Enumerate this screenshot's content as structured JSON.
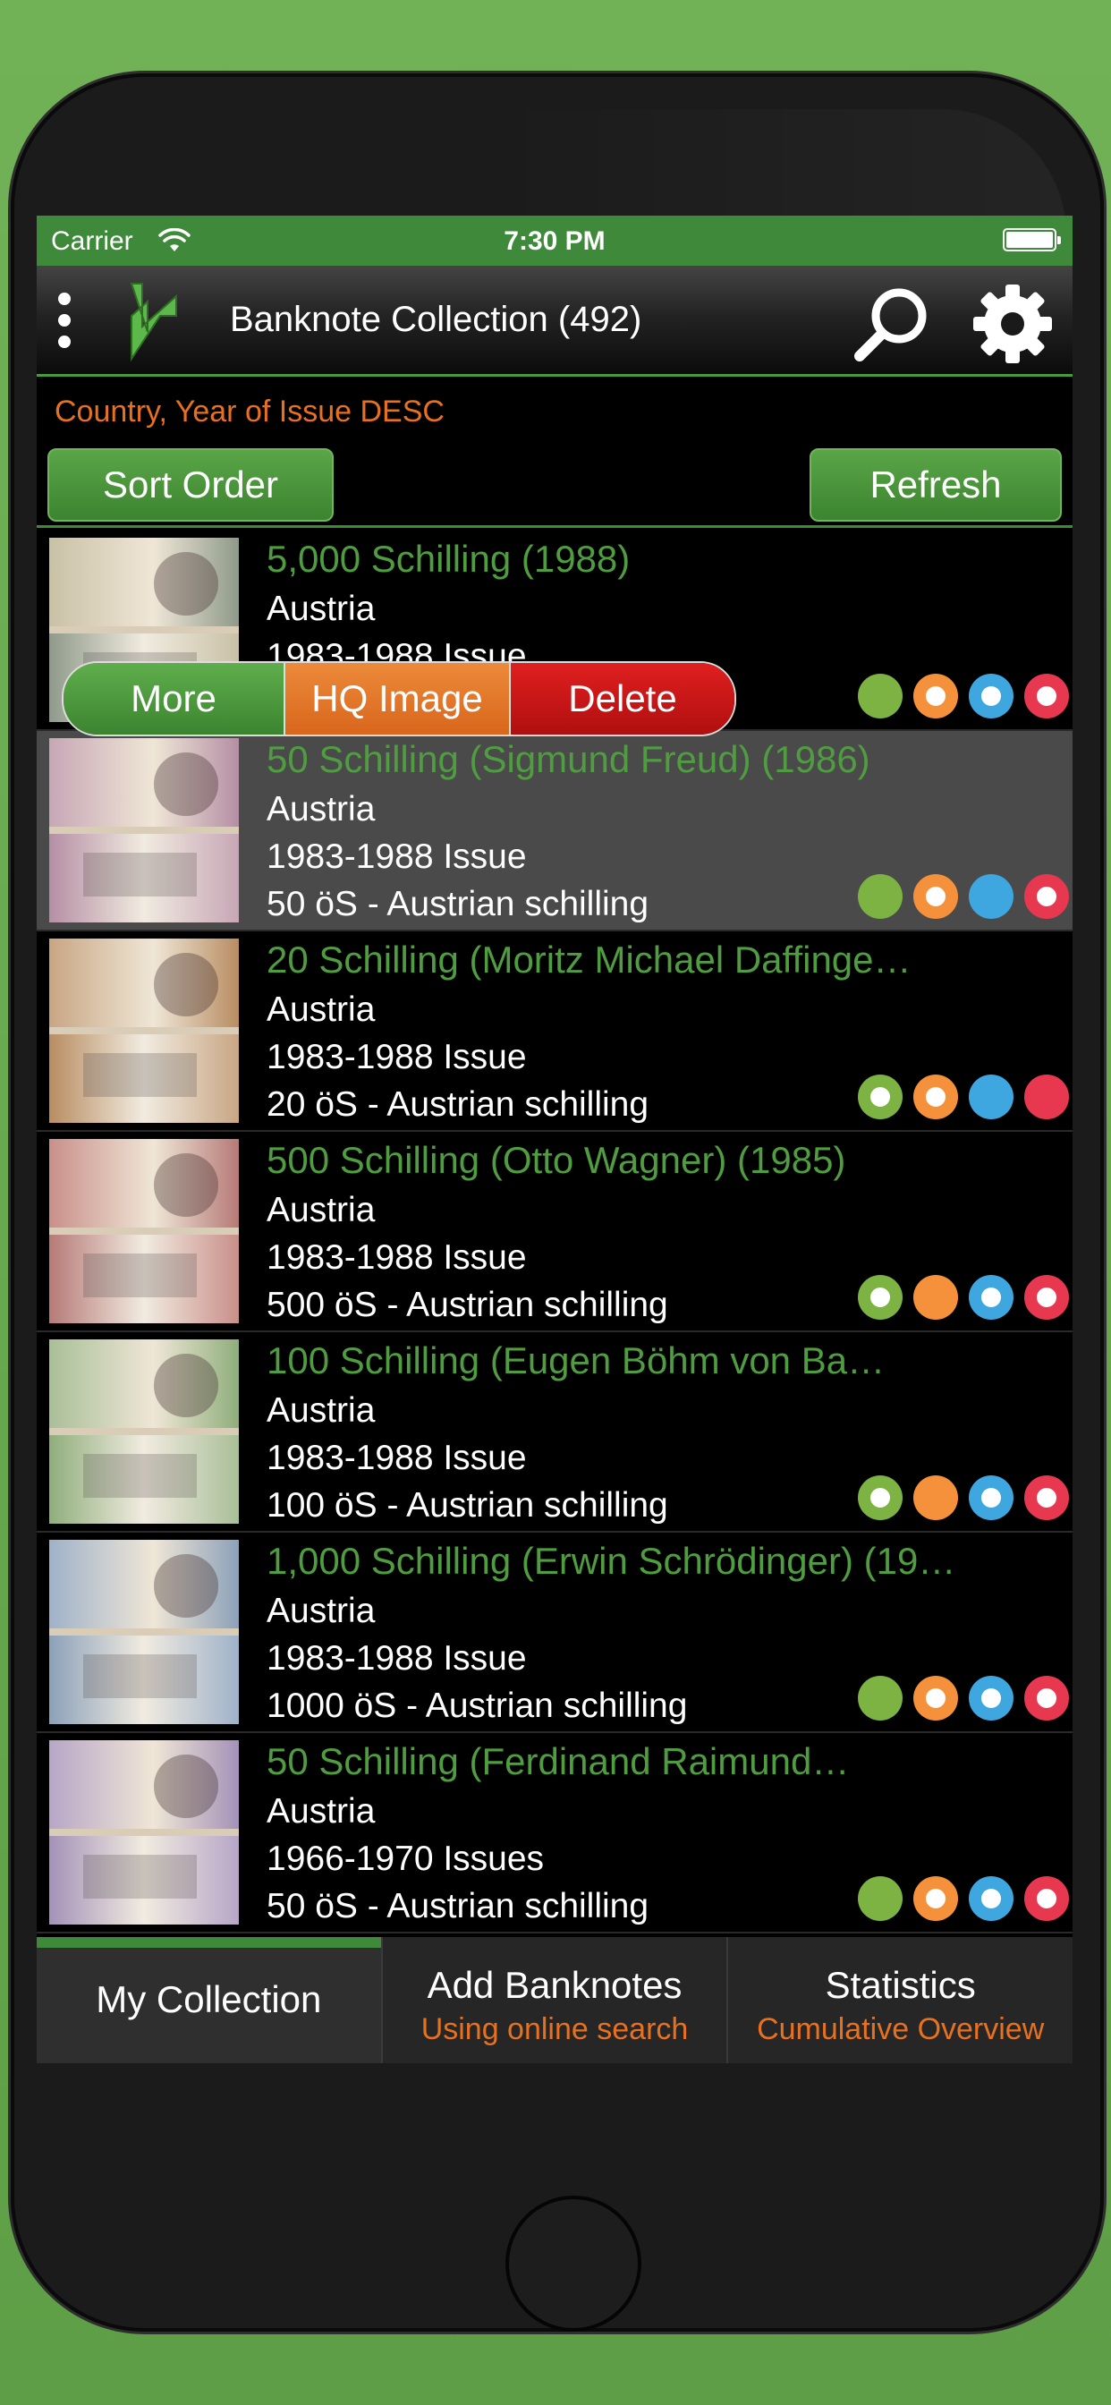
{
  "status_bar": {
    "carrier": "Carrier",
    "time": "7:30 PM"
  },
  "nav": {
    "title": "Banknote Collection (492)"
  },
  "sort": {
    "label": "Country, Year of Issue DESC",
    "sort_button": "Sort Order",
    "refresh_button": "Refresh"
  },
  "swipe_actions": {
    "more": "More",
    "hq_image": "HQ Image",
    "delete": "Delete"
  },
  "items": [
    {
      "title": "5,000 Schilling (1988)",
      "country": "Austria",
      "issue": "1983-1988 Issue",
      "denomination": "",
      "dots": [
        "green",
        "orange-hollow",
        "blue-hollow",
        "red-hollow"
      ],
      "note_colors": [
        "#c9c1a6",
        "#8f9a8a"
      ]
    },
    {
      "title": "50 Schilling (Sigmund Freud) (1986)",
      "country": "Austria",
      "issue": "1983-1988 Issue",
      "denomination": "50 öS - Austrian schilling",
      "dots": [
        "green",
        "orange-hollow",
        "blue",
        "red-hollow"
      ],
      "note_colors": [
        "#c7a7b6",
        "#b58fa5"
      ]
    },
    {
      "title": "20 Schilling (Moritz Michael Daffinge…",
      "country": "Austria",
      "issue": "1983-1988 Issue",
      "denomination": "20 öS - Austrian schilling",
      "dots": [
        "green-hollow",
        "orange-hollow",
        "blue",
        "red"
      ],
      "note_colors": [
        "#c8a684",
        "#b88d62"
      ]
    },
    {
      "title": "500 Schilling (Otto Wagner) (1985)",
      "country": "Austria",
      "issue": "1983-1988 Issue",
      "denomination": "500 öS - Austrian schilling",
      "dots": [
        "green-hollow",
        "orange",
        "blue-hollow",
        "red-hollow"
      ],
      "note_colors": [
        "#c98f8a",
        "#b67a78"
      ]
    },
    {
      "title": "100 Schilling (Eugen Böhm von Ba…",
      "country": "Austria",
      "issue": "1983-1988 Issue",
      "denomination": "100 öS - Austrian schilling",
      "dots": [
        "green-hollow",
        "orange",
        "blue-hollow",
        "red-hollow"
      ],
      "note_colors": [
        "#a9bf98",
        "#8fae7c"
      ]
    },
    {
      "title": "1,000 Schilling (Erwin Schrödinger) (19…",
      "country": "Austria",
      "issue": "1983-1988 Issue",
      "denomination": "1000 öS - Austrian schilling",
      "dots": [
        "green",
        "orange-hollow",
        "blue-hollow",
        "red-hollow"
      ],
      "note_colors": [
        "#9fb2c9",
        "#8ca1b9"
      ]
    },
    {
      "title": "50 Schilling (Ferdinand Raimund…",
      "country": "Austria",
      "issue": "1966-1970 Issues",
      "denomination": "50 öS - Austrian schilling",
      "dots": [
        "green",
        "orange-hollow",
        "blue-hollow",
        "red-hollow"
      ],
      "note_colors": [
        "#b7a6c7",
        "#a492b8"
      ]
    }
  ],
  "tabs": [
    {
      "title": "My Collection",
      "subtitle": ""
    },
    {
      "title": "Add Banknotes",
      "subtitle": "Using online search"
    },
    {
      "title": "Statistics",
      "subtitle": "Cumulative Overview"
    }
  ]
}
